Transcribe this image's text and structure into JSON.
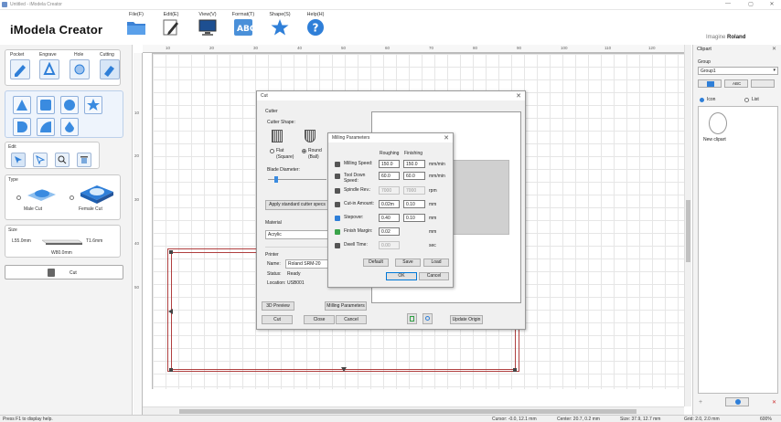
{
  "window": {
    "title": "Untitled - iModela Creator",
    "controls": [
      "—",
      "▢",
      "✕"
    ]
  },
  "app_name": "iModela Creator",
  "brand": {
    "prefix": "Imagine",
    "name": "Roland"
  },
  "menu": [
    {
      "label": "File(F)",
      "icon": "folder-icon"
    },
    {
      "label": "Edit(E)",
      "icon": "pencil-icon"
    },
    {
      "label": "View(V)",
      "icon": "monitor-icon"
    },
    {
      "label": "Format(T)",
      "icon": "text-format-icon"
    },
    {
      "label": "Shape(S)",
      "icon": "star-icon"
    },
    {
      "label": "Help(H)",
      "icon": "help-icon"
    }
  ],
  "tools": {
    "modes": [
      "Pocket",
      "Engrave",
      "Hole",
      "Cutting"
    ],
    "edit_label": "Edit",
    "type_label": "Type",
    "type_options": [
      "Male Cut",
      "Female Cut"
    ],
    "size_label": "Size",
    "size": {
      "l": "L55.0mm",
      "t": "T1.6mm",
      "w": "W80.0mm"
    },
    "cut_button": "Cut"
  },
  "ruler": {
    "top": [
      "10",
      "20",
      "30",
      "40",
      "50",
      "60",
      "70",
      "80",
      "90",
      "100",
      "110",
      "120"
    ],
    "left": [
      "10",
      "20",
      "30",
      "40",
      "50"
    ]
  },
  "status": {
    "help": "Press F1 to display help.",
    "cursor": "Cursor: -0.0, 12.1 mm",
    "center": "Center: 20.7, 0.2 mm",
    "size": "Size: 37.9, 12.7 mm",
    "grid": "Grid: 2.0, 2.0 mm",
    "zoom": "600%"
  },
  "clipart": {
    "title": "Clipart",
    "group_label": "Group",
    "group_value": "Group1",
    "abc_label": "ABC",
    "view_icon": "Icon",
    "view_list": "List",
    "new_clipart": "New clipart"
  },
  "cut_dialog": {
    "title": "Cut",
    "cutter_label": "Cutter",
    "shape_label": "Cutter Shape:",
    "flat": "Flat (Square)",
    "round": "Round (Ball)",
    "diameter_label": "Blade Diameter:",
    "apply_button": "Apply standard cutter specs",
    "material_label": "Material",
    "material_value": "Acrylic",
    "printer_label": "Printer",
    "name_label": "Name:",
    "name_value": "Roland SRM-20",
    "status_label": "Status:",
    "status_value": "Ready",
    "location_label": "Location:",
    "location_value": "USB001",
    "preview_button": "3D Preview",
    "milling_button": "Milling Parameters",
    "cut_button": "Cut",
    "close_button": "Close",
    "cancel_button": "Cancel",
    "update_button": "Update Origin"
  },
  "milling_dialog": {
    "title": "Milling Parameters",
    "col_rough": "Roughing",
    "col_finish": "Finishing",
    "rows": [
      {
        "label": "Milling Speed:",
        "rough": "150.0",
        "finish": "150.0",
        "unit": "mm/min",
        "disabled": false
      },
      {
        "label": "Tool Down Speed:",
        "rough": "60.0",
        "finish": "60.0",
        "unit": "mm/min",
        "disabled": false
      },
      {
        "label": "Spindle Rev.:",
        "rough": "7000",
        "finish": "7000",
        "unit": "rpm",
        "disabled": true
      },
      {
        "label": "Cut-in Amount:",
        "rough": "0.02m",
        "finish": "0.10",
        "unit": "mm",
        "disabled": false
      },
      {
        "label": "Stepover:",
        "rough": "0.40",
        "finish": "0.10",
        "unit": "mm",
        "disabled": false
      },
      {
        "label": "Finish Margin:",
        "rough": "0.02",
        "finish": "",
        "unit": "mm",
        "disabled": false
      },
      {
        "label": "Dwell Time:",
        "rough": "0.00",
        "finish": "",
        "unit": "sec",
        "disabled": true
      }
    ],
    "default_button": "Default",
    "save_button": "Save",
    "load_button": "Load",
    "ok_button": "OK",
    "cancel_button": "Cancel"
  }
}
